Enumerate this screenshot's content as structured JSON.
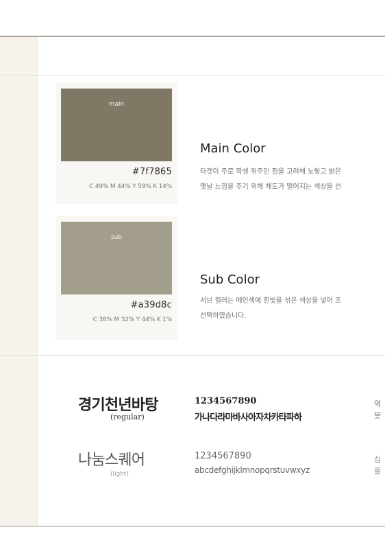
{
  "colors": {
    "main": {
      "swatch_label": "main",
      "name": "Main Color",
      "hex": "#7f7865",
      "cmyk": "C 49% M 44% Y 59% K 14%",
      "fill": "#7f7865",
      "description": [
        "타겟이 주로 학생 위주인 점을 고려해 노랗고 밝은",
        "옛날 느낌을 주기 위해  채도가 떨어지는 색상을 선"
      ]
    },
    "sub": {
      "swatch_label": "sub",
      "name": "Sub Color",
      "hex": "#a39d8c",
      "cmyk": "C 38% M 32% Y 44% K 1%",
      "fill": "#a39d8c",
      "description": [
        "서브 컬러는 메인색에 흰빛을 섞은 색상을 넣어 조",
        "선택하였습니다."
      ]
    }
  },
  "fonts": [
    {
      "name": "경기천년바탕",
      "weight": "(regular)",
      "sample_numbers": "1234567890",
      "sample_text": "가나다라마바사아자차카타파하",
      "edge_text": [
        "역",
        "붓"
      ]
    },
    {
      "name": "나눔스퀘어",
      "weight": "(light)",
      "sample_numbers": "1234567890",
      "sample_text": "abcdefghijklmnopqrstuvwxyz",
      "edge_text": [
        "심",
        "를"
      ]
    }
  ]
}
